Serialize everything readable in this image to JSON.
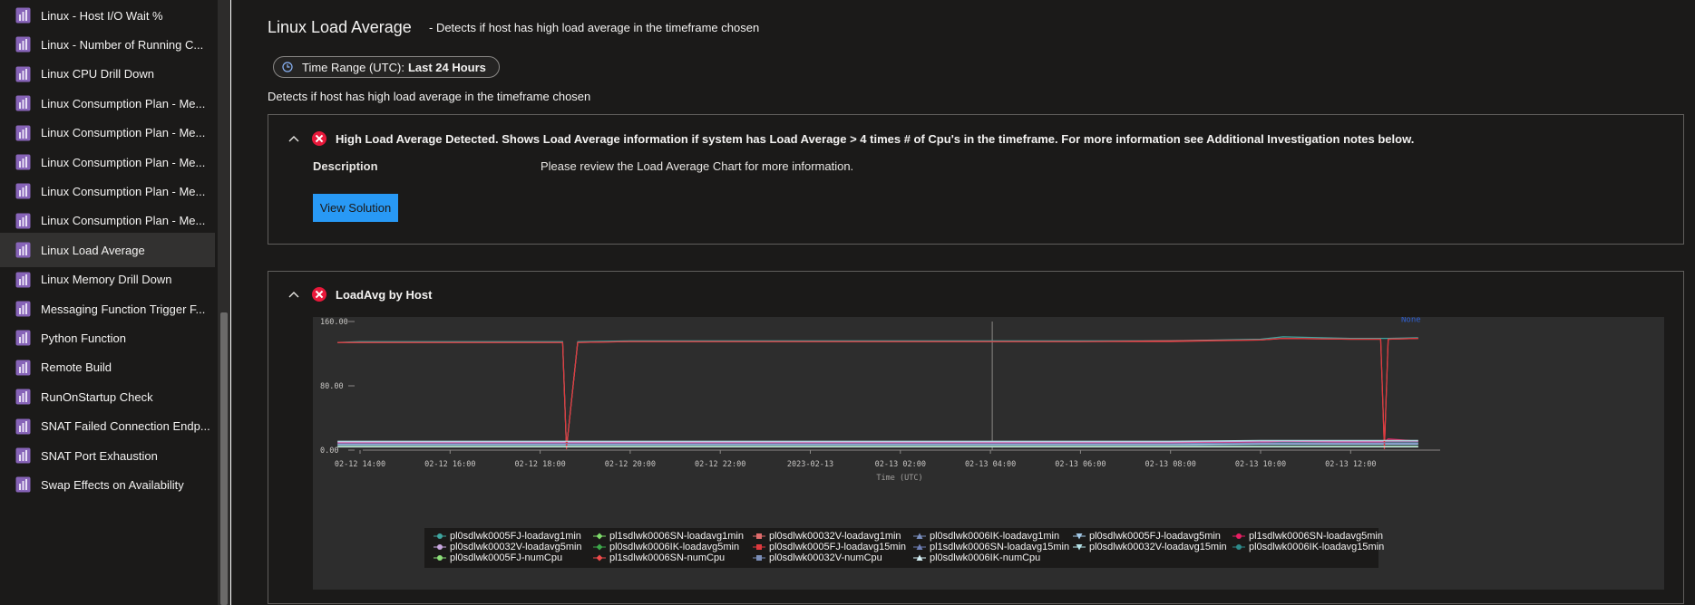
{
  "sidebar": {
    "items": [
      {
        "label": "Linux - Host I/O Wait %",
        "active": false
      },
      {
        "label": "Linux - Number of Running C...",
        "active": false
      },
      {
        "label": "Linux CPU Drill Down",
        "active": false
      },
      {
        "label": "Linux Consumption Plan - Me...",
        "active": false
      },
      {
        "label": "Linux Consumption Plan - Me...",
        "active": false
      },
      {
        "label": "Linux Consumption Plan - Me...",
        "active": false
      },
      {
        "label": "Linux Consumption Plan - Me...",
        "active": false
      },
      {
        "label": "Linux Consumption Plan - Me...",
        "active": false
      },
      {
        "label": "Linux Load Average",
        "active": true
      },
      {
        "label": "Linux Memory Drill Down",
        "active": false
      },
      {
        "label": "Messaging Function Trigger F...",
        "active": false
      },
      {
        "label": "Python Function",
        "active": false
      },
      {
        "label": "Remote Build",
        "active": false
      },
      {
        "label": "RunOnStartup Check",
        "active": false
      },
      {
        "label": "SNAT Failed Connection Endp...",
        "active": false
      },
      {
        "label": "SNAT Port Exhaustion",
        "active": false
      },
      {
        "label": "Swap Effects on Availability",
        "active": false
      }
    ]
  },
  "header": {
    "title": "Linux Load Average",
    "subtitle": "-  Detects if host has high load average in the timeframe chosen",
    "time_range_label": "Time Range (UTC):",
    "time_range_value": "Last 24 Hours",
    "description": "Detects if host has high load average in the timeframe chosen"
  },
  "insight": {
    "title": "High Load Average Detected. Shows Load Average information if system has Load Average > 4 times # of Cpu's in the timeframe. For more information see Additional Investigation notes below.",
    "description_label": "Description",
    "description_text": "Please review the Load Average Chart for more information.",
    "button_label": "View Solution"
  },
  "chart_panel": {
    "title": "LoadAvg by Host",
    "overlay_label": "None"
  },
  "colors": {
    "accent": "#2899f5",
    "error": "#e8183a",
    "background": "#1b1a19",
    "chart_background": "#2d2d2d"
  },
  "chart_data": {
    "type": "line",
    "xlabel": "Time (UTC)",
    "ylabel": "",
    "ylim": [
      0,
      160
    ],
    "yticks": [
      "160.00",
      "80.00",
      "0.00"
    ],
    "xticks": [
      "02-12 14:00",
      "02-12 16:00",
      "02-12 18:00",
      "02-12 20:00",
      "02-12 22:00",
      "2023-02-13",
      "02-13 02:00",
      "02-13 04:00",
      "02-13 06:00",
      "02-13 08:00",
      "02-13 10:00",
      "02-13 12:00"
    ],
    "x": [
      "02-12 13:30",
      "02-12 14:00",
      "02-12 16:00",
      "02-12 18:00",
      "02-12 18:30",
      "02-12 18:35",
      "02-12 18:50",
      "02-12 20:00",
      "02-12 22:00",
      "2023-02-13",
      "02-13 02:00",
      "02-13 04:00",
      "02-13 06:00",
      "02-13 08:00",
      "02-13 10:00",
      "02-13 10:30",
      "02-13 12:00",
      "02-13 12:40",
      "02-13 12:45",
      "02-13 12:50",
      "02-13 13:30"
    ],
    "series": [
      {
        "name": "pl0sdlwk0005FJ-loadavg1min",
        "color": "#3fa6a0",
        "values": [
          134,
          135,
          135,
          135,
          135,
          2,
          135,
          136,
          136,
          136,
          136,
          136,
          136,
          136,
          138,
          141,
          139,
          139,
          139,
          139,
          140
        ]
      },
      {
        "name": "pl1sdlwk0006SN-loadavg1min",
        "color": "#7fdc6b",
        "values": [
          8,
          8,
          8,
          8,
          8,
          8,
          8,
          8,
          8,
          8,
          8,
          8,
          8,
          8,
          9,
          9,
          9,
          9,
          9,
          9,
          9
        ]
      },
      {
        "name": "pl0sdlwk00032V-loadavg1min",
        "color": "#e06c6c",
        "values": [
          134,
          134,
          134,
          134,
          134,
          2,
          134,
          135,
          135,
          135,
          135,
          135,
          135,
          136,
          137,
          139,
          138,
          138,
          2,
          138,
          139
        ]
      },
      {
        "name": "pl0sdlwk0006IK-loadavg1min",
        "color": "#7a8fbf",
        "values": [
          6,
          6,
          6,
          6,
          6,
          6,
          6,
          6,
          6,
          6,
          6,
          6,
          6,
          6,
          7,
          7,
          7,
          7,
          7,
          7,
          7
        ]
      },
      {
        "name": "pl0sdlwk0005FJ-loadavg5min",
        "color": "#a3c9e6",
        "values": [
          7,
          7,
          7,
          7,
          7,
          7,
          7,
          7,
          7,
          7,
          7,
          7,
          7,
          7,
          8,
          8,
          8,
          8,
          8,
          8,
          8
        ]
      },
      {
        "name": "pl1sdlwk0006SN-loadavg5min",
        "color": "#e81e63",
        "values": [
          9,
          9,
          9,
          9,
          9,
          9,
          9,
          9,
          9,
          9,
          9,
          9,
          9,
          9,
          10,
          11,
          10,
          10,
          10,
          14,
          11
        ]
      },
      {
        "name": "pl0sdlwk00032V-loadavg5min",
        "color": "#c9a8e0",
        "values": [
          10,
          10,
          10,
          10,
          10,
          10,
          10,
          10,
          10,
          10,
          10,
          10,
          10,
          10,
          11,
          11,
          11,
          11,
          11,
          11,
          11
        ]
      },
      {
        "name": "pl0sdlwk0006IK-loadavg5min",
        "color": "#3da84a",
        "values": [
          5,
          5,
          5,
          5,
          5,
          5,
          5,
          5,
          5,
          5,
          5,
          5,
          5,
          5,
          5,
          5,
          5,
          5,
          5,
          5,
          5
        ]
      },
      {
        "name": "pl0sdlwk0005FJ-loadavg15min",
        "color": "#e0393e",
        "values": [
          134,
          134,
          134,
          134,
          134,
          2,
          134,
          135,
          135,
          135,
          135,
          135,
          135,
          135,
          137,
          139,
          138,
          138,
          2,
          138,
          139
        ]
      },
      {
        "name": "pl1sdlwk0006SN-loadavg15min",
        "color": "#6e7fb5",
        "values": [
          8,
          8,
          8,
          8,
          8,
          8,
          8,
          8,
          8,
          8,
          8,
          8,
          8,
          8,
          9,
          9,
          9,
          9,
          9,
          9,
          9
        ]
      },
      {
        "name": "pl0sdlwk00032V-loadavg15min",
        "color": "#b6e3e8",
        "values": [
          11,
          11,
          11,
          11,
          11,
          11,
          11,
          11,
          11,
          11,
          11,
          11,
          11,
          11,
          12,
          12,
          12,
          12,
          12,
          12,
          12
        ]
      },
      {
        "name": "pl0sdlwk0006IK-loadavg15min",
        "color": "#2e8b8b",
        "values": [
          4,
          4,
          4,
          4,
          4,
          4,
          4,
          4,
          4,
          4,
          4,
          4,
          4,
          4,
          4,
          4,
          4,
          4,
          4,
          4,
          4
        ]
      },
      {
        "name": "pl0sdlwk0005FJ-numCpu",
        "color": "#8de07a",
        "values": [
          4,
          4,
          4,
          4,
          4,
          4,
          4,
          4,
          4,
          4,
          4,
          4,
          4,
          4,
          4,
          4,
          4,
          4,
          4,
          4,
          4
        ]
      },
      {
        "name": "pl1sdlwk0006SN-numCpu",
        "color": "#ef4a4a",
        "values": [
          4,
          4,
          4,
          4,
          4,
          4,
          4,
          4,
          4,
          4,
          4,
          4,
          4,
          4,
          4,
          4,
          4,
          4,
          4,
          4,
          4
        ]
      },
      {
        "name": "pl0sdlwk00032V-numCpu",
        "color": "#7b8eb8",
        "values": [
          4,
          4,
          4,
          4,
          4,
          4,
          4,
          4,
          4,
          4,
          4,
          4,
          4,
          4,
          4,
          4,
          4,
          4,
          4,
          4,
          4
        ]
      },
      {
        "name": "pl0sdlwk0006IK-numCpu",
        "color": "#d6f0f5",
        "values": [
          4,
          4,
          4,
          4,
          4,
          4,
          4,
          4,
          4,
          4,
          4,
          4,
          4,
          4,
          4,
          4,
          4,
          4,
          4,
          4,
          4
        ]
      }
    ]
  }
}
